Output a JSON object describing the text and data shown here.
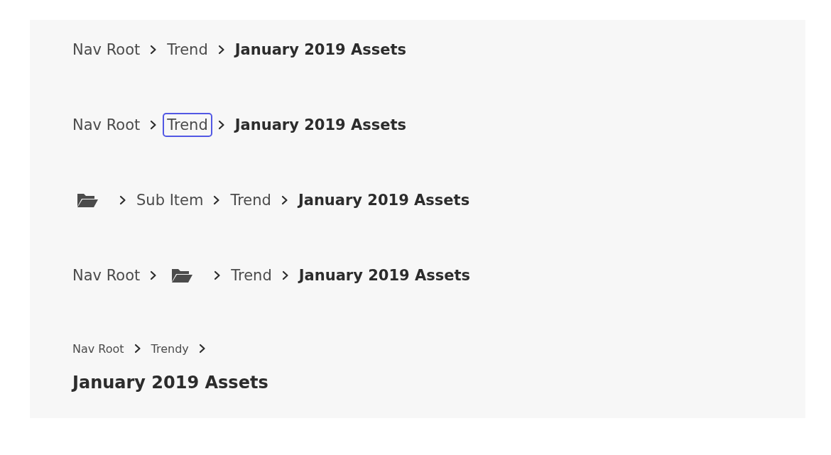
{
  "breadcrumbs": [
    {
      "multiline": false,
      "items": [
        {
          "kind": "link",
          "label": "Nav Root",
          "focused": false
        },
        {
          "kind": "link",
          "label": "Trend",
          "focused": false
        },
        {
          "kind": "current",
          "label": "January 2019 Assets"
        }
      ]
    },
    {
      "multiline": false,
      "items": [
        {
          "kind": "link",
          "label": "Nav Root",
          "focused": false
        },
        {
          "kind": "link",
          "label": "Trend",
          "focused": true
        },
        {
          "kind": "current",
          "label": "January 2019 Assets"
        }
      ]
    },
    {
      "multiline": false,
      "items": [
        {
          "kind": "folder",
          "focused": false
        },
        {
          "kind": "link",
          "label": "Sub Item",
          "focused": false
        },
        {
          "kind": "link",
          "label": "Trend",
          "focused": false
        },
        {
          "kind": "current",
          "label": "January 2019 Assets"
        }
      ]
    },
    {
      "multiline": false,
      "items": [
        {
          "kind": "link",
          "label": "Nav Root",
          "focused": false
        },
        {
          "kind": "folder",
          "focused": false
        },
        {
          "kind": "link",
          "label": "Trend",
          "focused": false
        },
        {
          "kind": "current",
          "label": "January 2019 Assets"
        }
      ]
    },
    {
      "multiline": true,
      "items": [
        {
          "kind": "link",
          "label": "Nav Root",
          "focused": false
        },
        {
          "kind": "link",
          "label": "Trendy",
          "focused": false
        },
        {
          "kind": "current",
          "label": "January 2019 Assets"
        }
      ]
    }
  ]
}
